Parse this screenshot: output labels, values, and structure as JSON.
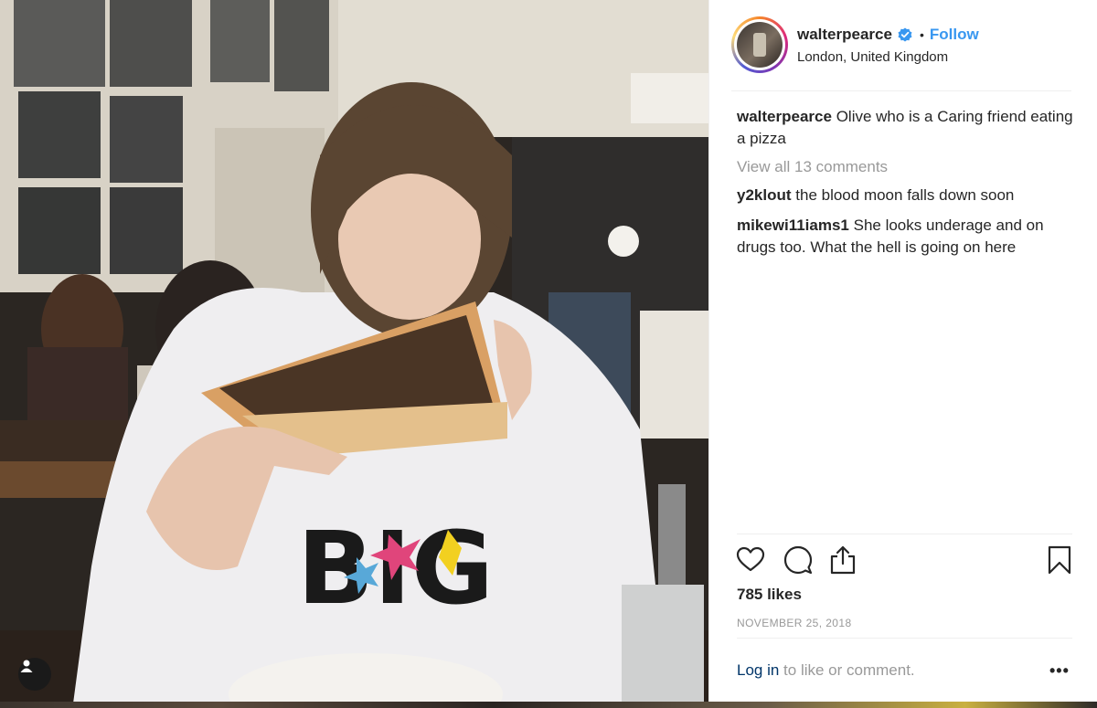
{
  "post": {
    "username": "walterpearce",
    "follow_label": "Follow",
    "separator": "•",
    "location": "London, United Kingdom"
  },
  "caption": {
    "username": "walterpearce",
    "text": "Olive who is a Caring friend eating a pizza"
  },
  "view_all_comments": "View all 13 comments",
  "comments": [
    {
      "username": "y2klout",
      "text": "the blood moon falls down soon"
    },
    {
      "username": "mikewi11iams1",
      "text": "She looks underage and on drugs too. What the hell is going on here"
    }
  ],
  "likes": "785 likes",
  "date": "NOVEMBER 25, 2018",
  "footer": {
    "login_link": "Log in",
    "login_suffix": " to like or comment.",
    "more_label": "•••"
  },
  "icons": {
    "like": "heart-icon",
    "comment": "comment-bubble-icon",
    "share": "share-icon",
    "save": "bookmark-icon",
    "verified": "verified-badge-icon",
    "tag": "user-tag-icon"
  },
  "colors": {
    "link_blue": "#3897f0",
    "login_blue": "#003569",
    "muted": "#999999",
    "text": "#262626"
  }
}
